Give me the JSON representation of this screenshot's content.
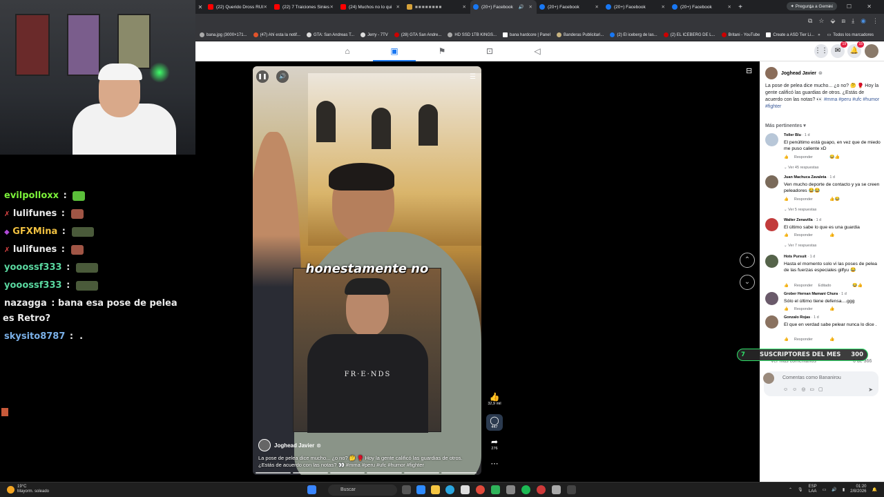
{
  "browser": {
    "tabs": [
      {
        "label": "(22) Querido Dross RUI",
        "color": "#ff0000"
      },
      {
        "label": "(22) 7 Traiciones Sinies",
        "color": "#ff0000"
      },
      {
        "label": "(24) Muchos no lo qui",
        "color": "#ff0000"
      },
      {
        "label": "",
        "color": "#d6a23a"
      },
      {
        "label": "(20+) Facebook",
        "color": "#1877f2",
        "active": true
      },
      {
        "label": "(20+) Facebook",
        "color": "#1877f2"
      },
      {
        "label": "(20+) Facebook",
        "color": "#1877f2"
      },
      {
        "label": "(20+) Facebook",
        "color": "#1877f2"
      }
    ],
    "gemini_label": "Pregunta a Gemini",
    "bookmarks": [
      "bana.jpg (3000×171...",
      "(47) Ahí esta la notif...",
      "GTA: San Andreas T...",
      "Jerry - 7TV",
      "(28) GTA San Andre...",
      "HD SSD 1TB KINGS...",
      "bana hardcore | Panel",
      "Banderas Publicitari...",
      "(2) El iceberg de las...",
      "(2) EL ICEBERG DE L...",
      "Britani - YouTube",
      "Create a ASD Tier Li..."
    ],
    "all_bookmarks": "Todos los marcadores"
  },
  "fbnav": {
    "notif_badge": "15",
    "msg_badge": "19"
  },
  "video": {
    "overlay_text": "honestamente no",
    "shirt_text": "FR·E·NDS",
    "author": "Joghead Javier",
    "description": "La pose de pelea dice mucho... ¿o no? 🤔 🥊 Hoy la gente calificó las guardias de otros. ¿Estás de acuerdo con las notas? 👀 #mma #peru #ufc #humor #fighter",
    "likes": "32,9 mil",
    "comments": "447",
    "shares": "276"
  },
  "panel": {
    "author": "Joghead Javier",
    "description": "La pose de pelea dice mucho... ¿o no? 🤔 🥊 Hoy la gente calificó las guardias de otros. ¿Estás de acuerdo con las notas? 👀",
    "hashtags": "#mma #peru #ufc #humor #fighter",
    "sort_label": "Más pertinentes ▾",
    "comments": [
      {
        "name": "Toller Blu",
        "time": "· 1 d",
        "text": "El penúltimo está guapo, en vez que de miedo me puso caliente xD",
        "reply": "Responder",
        "more": "Ver 45 respuestas",
        "color": "#b8c7d8"
      },
      {
        "name": "Juan Machuca Zavaleta",
        "time": "· 1 d",
        "text": "Ven mucho deporte de contacto y ya se creen peleadores 😂😂",
        "reply": "Responder",
        "more": "Ver 5 respuestas",
        "color": "#7a6a5a"
      },
      {
        "name": "Walter Zenavilla",
        "time": "· 1 d",
        "text": "El último sabe lo que es una guardia",
        "reply": "Responder",
        "more": "Ver 7 respuestas",
        "color": "#c23b3b"
      },
      {
        "name": "Hots Pursuit",
        "time": "· 1 d",
        "text": "Hasta el momento solo vi las poses de pelea de las fuerzas especiales gilfyu 😂",
        "reply": "Responder",
        "edited": "Editado",
        "color": "#55634a"
      },
      {
        "name": "Grober Hernan Mamani Chura",
        "time": "· 1 d",
        "text": "Sólo el último tiene defensa....ggg",
        "reply": "Responder",
        "color": "#6a5a6a"
      },
      {
        "name": "Gonzalo Rojas",
        "time": "· 1 d",
        "text": "El que en verdad sabe pelear nunca lo dice .",
        "reply": "Responder",
        "color": "#8a7260"
      }
    ],
    "view_more": "Ver más comentarios",
    "count": "6 de 366",
    "composer_placeholder": "Comentas como Bananirou"
  },
  "subs_bar": {
    "number": "7",
    "label": "SUSCRIPTORES DEL MES",
    "count": "300"
  },
  "stream_chat": [
    {
      "user": "evilpolloxx",
      "user_color": "#7cf23a",
      "msg": "",
      "emote": "#5bbf3a"
    },
    {
      "user": "lulifunes",
      "user_color": "#e8e8e8",
      "msg": "",
      "emote": "#a05545"
    },
    {
      "user": "GFXMina",
      "user_color": "#f0c040",
      "msg": "",
      "emote": "#4a5a3a"
    },
    {
      "user": "lulifunes",
      "user_color": "#e8e8e8",
      "msg": "",
      "emote": "#a05545"
    },
    {
      "user": "yooossf333",
      "user_color": "#5ad8a0",
      "msg": "",
      "emote": "#4a5a3a"
    },
    {
      "user": "yooossf333",
      "user_color": "#5ad8a0",
      "msg": "",
      "emote": "#4a5a3a"
    },
    {
      "user": "nazagga",
      "user_color": "#e8e8e8",
      "msg": "bana esa pose de pelea",
      "msg2": "es Retro?"
    },
    {
      "user": "skysito8787",
      "user_color": "#7ab0e8",
      "msg": "."
    }
  ],
  "taskbar": {
    "temp": "19°C",
    "weather": "Mayorm. soleado",
    "search": "Buscar",
    "lang": "ESP",
    "lang2": "LAA",
    "time": "01:20",
    "date": "2/8/2026"
  }
}
